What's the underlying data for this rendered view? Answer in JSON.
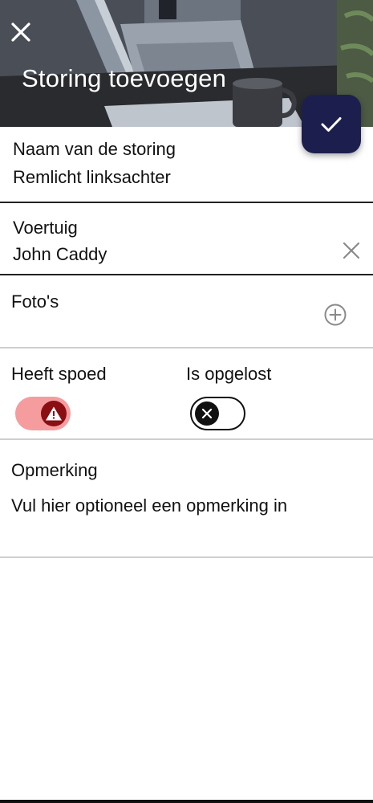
{
  "header": {
    "title": "Storing toevoegen",
    "background_image": "laptop-and-coffee-mug-photo",
    "close_icon": "close-icon",
    "confirm_icon": "checkmark-icon"
  },
  "fields": {
    "name": {
      "label": "Naam van de storing",
      "value": "Remlicht linksachter"
    },
    "vehicle": {
      "label": "Voertuig",
      "value": "John Caddy",
      "clear_icon": "clear-icon"
    },
    "photos": {
      "label": "Foto's",
      "add_icon": "add-circle-icon"
    },
    "urgent": {
      "label": "Heeft spoed",
      "state": "on",
      "knob_icon": "warning-icon"
    },
    "resolved": {
      "label": "Is opgelost",
      "state": "off",
      "knob_icon": "close-icon"
    },
    "remark": {
      "label": "Opmerking",
      "placeholder": "Vul hier optioneel een opmerking in"
    }
  },
  "colors": {
    "fab": "#1c1f4e",
    "urgent_track": "#f59c9f",
    "urgent_knob": "#8b0e12",
    "divider_dark": "#222222",
    "divider_light": "#cfcfcf"
  }
}
